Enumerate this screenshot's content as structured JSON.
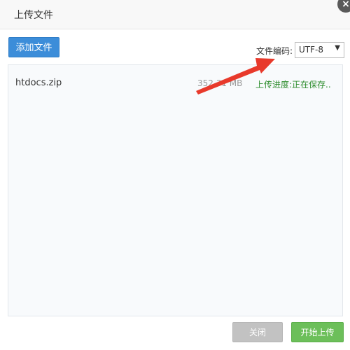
{
  "dialog": {
    "title": "上传文件"
  },
  "toolbar": {
    "add_file_label": "添加文件",
    "encoding_label": "文件编码:",
    "encoding_value": "UTF-8"
  },
  "files": [
    {
      "name": "htdocs.zip",
      "size": "352.31 MB",
      "status": "上传进度:正在保存.."
    }
  ],
  "footer": {
    "close_label": "关闭",
    "start_upload_label": "开始上传"
  },
  "icons": {
    "close": "close-icon",
    "dropdown": "chevron-down-icon",
    "annotation": "arrow-annotation"
  },
  "colors": {
    "primary": "#3c8dd9",
    "success": "#6cbf5a",
    "status_green": "#2a8b2a",
    "disabled": "#c2c2c2",
    "annotation_red": "#e8392b"
  }
}
